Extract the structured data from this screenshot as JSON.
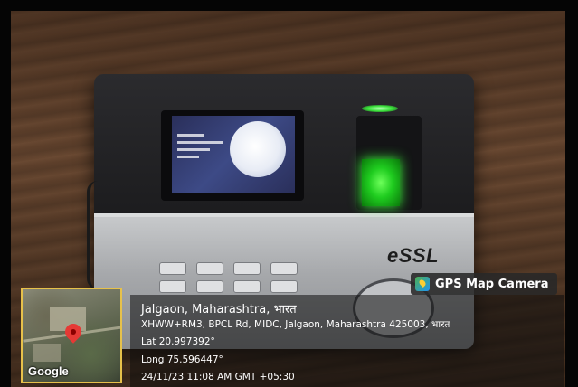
{
  "photo": {
    "subject": "biometric attendance device"
  },
  "device": {
    "brand": "eSSL"
  },
  "overlay": {
    "badge_label": "GPS Map Camera",
    "badge_icon": "gps-map-camera-icon",
    "location_title": "Jalgaon, Maharashtra, भारत",
    "address": "XHWW+RM3, BPCL Rd, MIDC, Jalgaon, Maharashtra 425003, भारत",
    "latitude": "Lat 20.997392°",
    "longitude": "Long 75.596447°",
    "timestamp": "24/11/23 11:08 AM GMT +05:30",
    "map_logo": "Google",
    "map_pin_icon": "location-pin-icon",
    "accent_color": "#e7c14a"
  }
}
